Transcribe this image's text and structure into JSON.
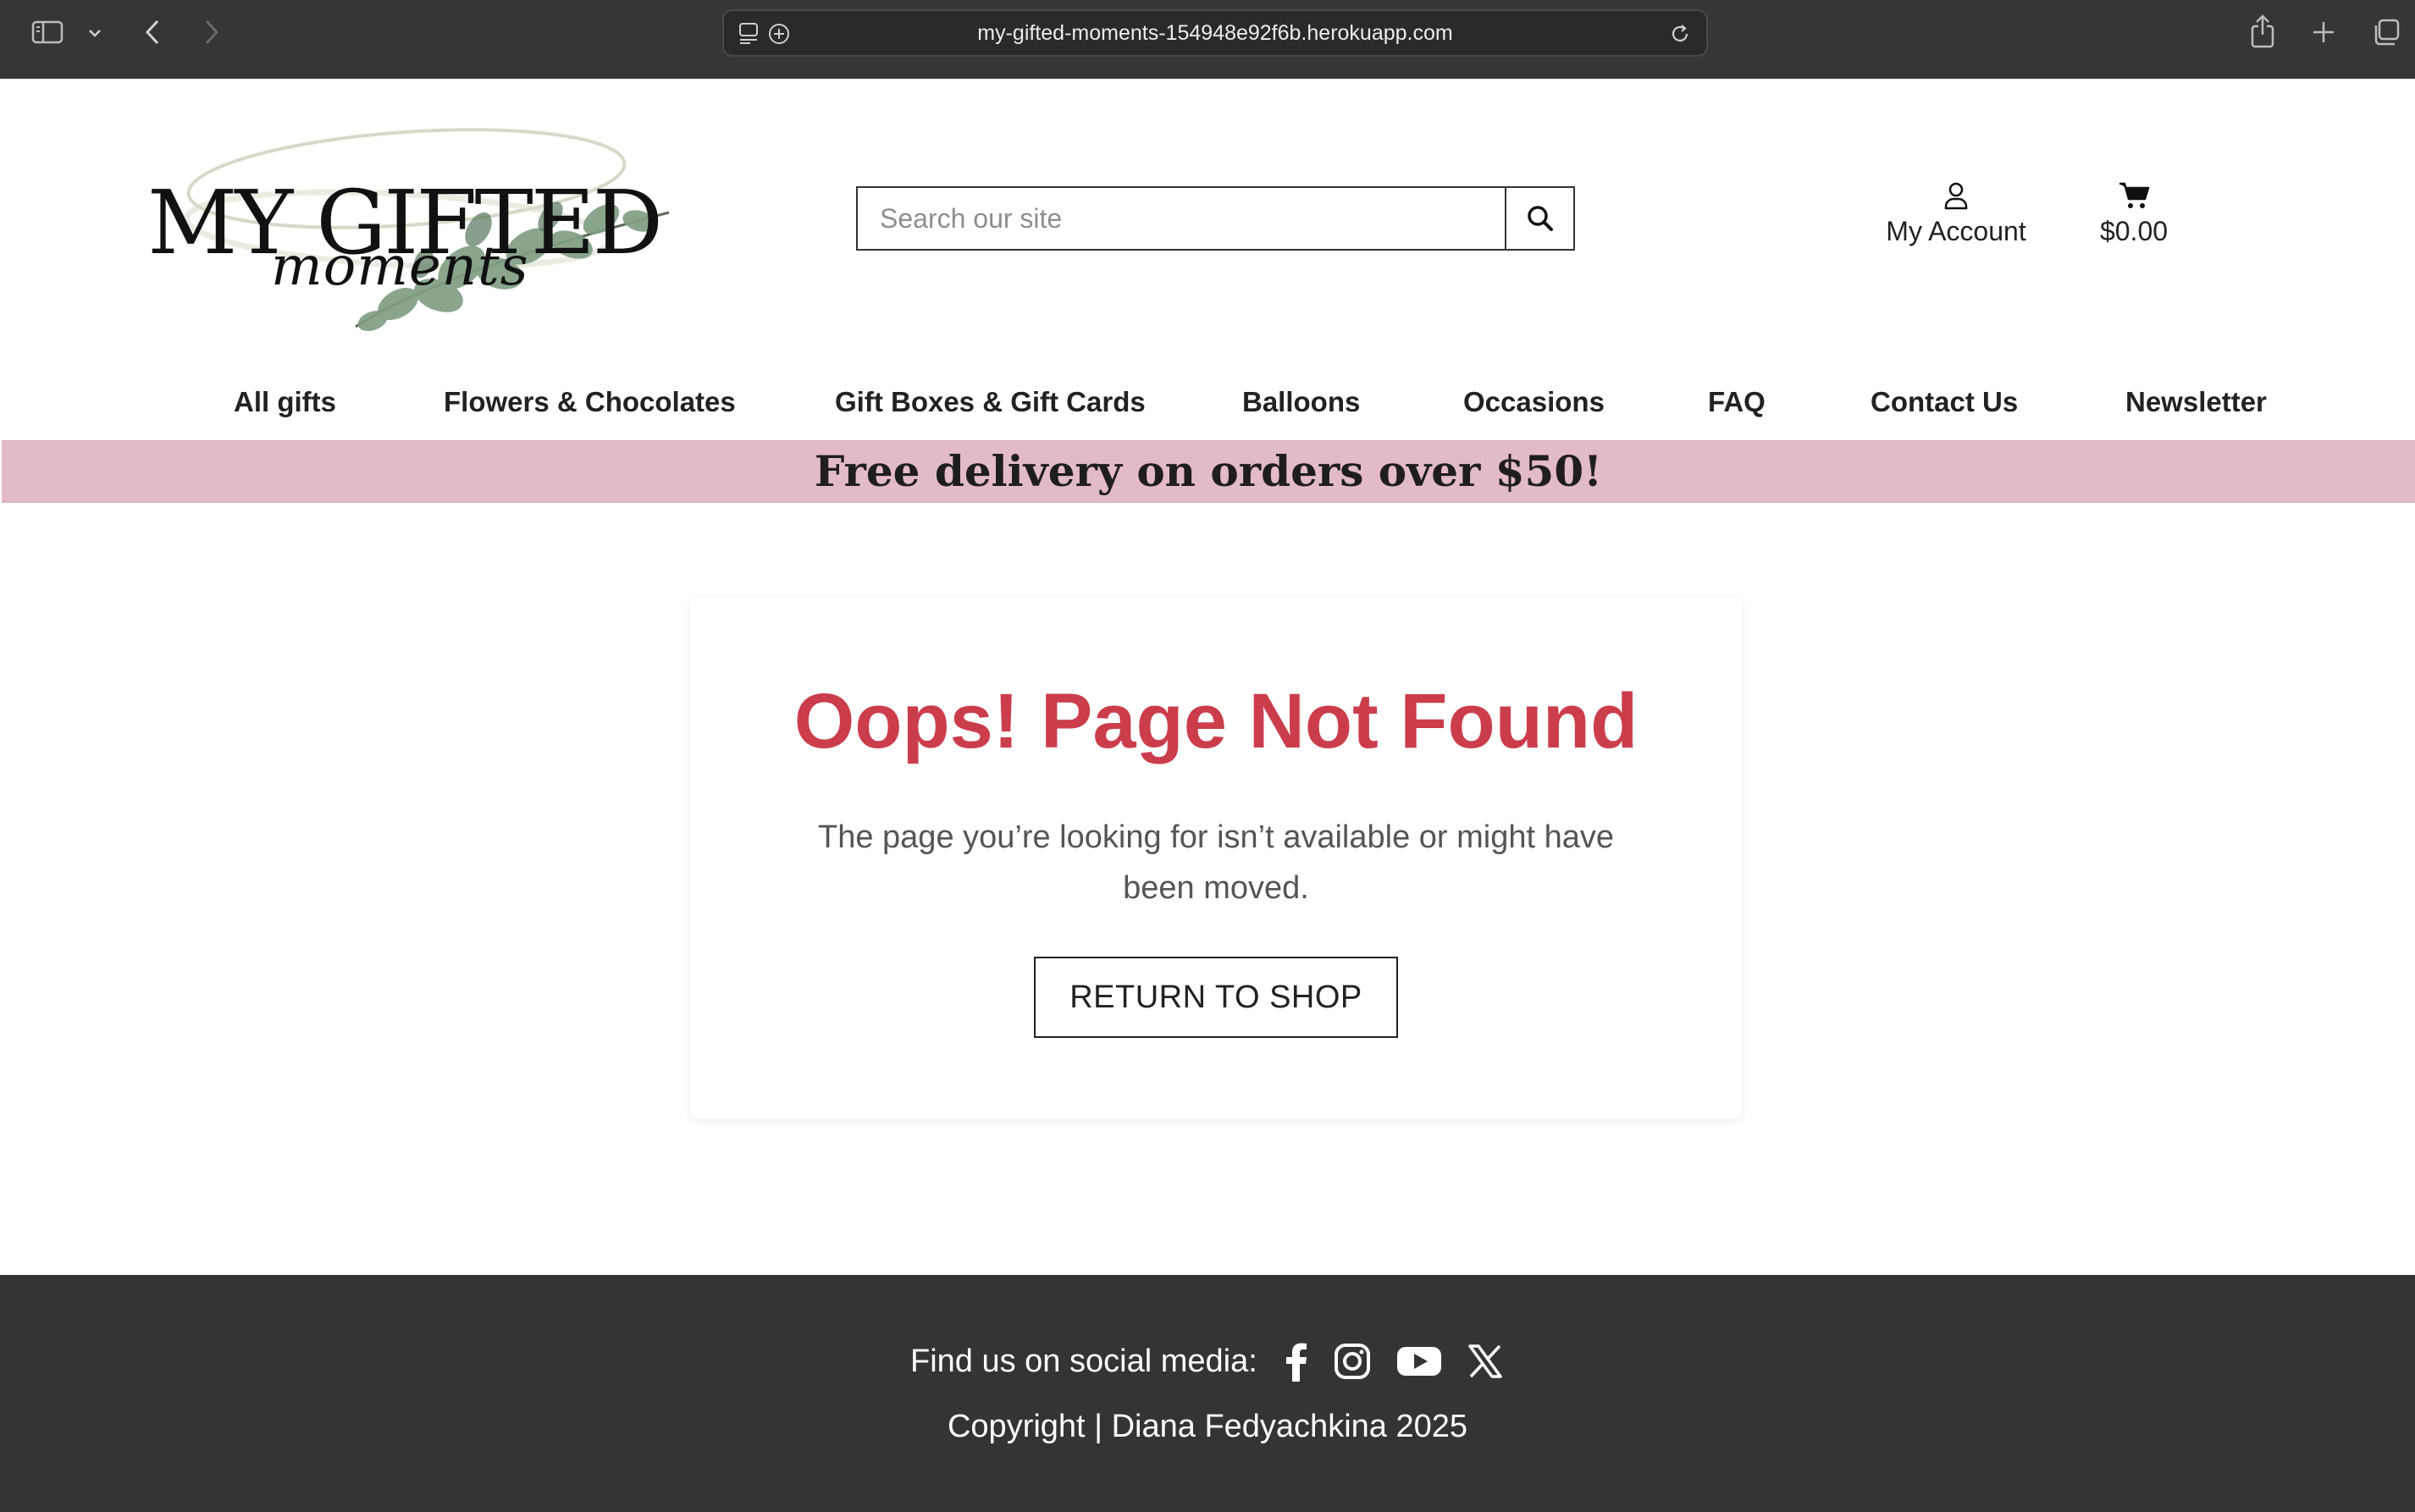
{
  "browser": {
    "url": "my-gifted-moments-154948e92f6b.herokuapp.com"
  },
  "header": {
    "logo": {
      "line1": "MY GIFTED",
      "line2": "moments"
    },
    "search": {
      "placeholder": "Search our site"
    },
    "account_label": "My Account",
    "cart_total": "$0.00"
  },
  "nav": {
    "items": [
      {
        "label": "All gifts"
      },
      {
        "label": "Flowers & Chocolates"
      },
      {
        "label": "Gift Boxes & Gift Cards"
      },
      {
        "label": "Balloons"
      },
      {
        "label": "Occasions"
      },
      {
        "label": "FAQ"
      },
      {
        "label": "Contact Us"
      },
      {
        "label": "Newsletter"
      }
    ]
  },
  "banner": {
    "text": "Free delivery on orders over $50!"
  },
  "error": {
    "title": "Oops! Page Not Found",
    "message": "The page you’re looking for isn’t available or might have been moved.",
    "button_label": "RETURN TO SHOP"
  },
  "footer": {
    "social_label": "Find us on social media:",
    "social_icons": [
      "facebook-icon",
      "instagram-icon",
      "youtube-icon",
      "x-icon"
    ],
    "copyright": "Copyright | Diana Fedyachkina 2025"
  },
  "colors": {
    "accent": "#cc3d4c",
    "banner": "#e3bac8",
    "footer": "#343434",
    "chrome": "#363636"
  }
}
